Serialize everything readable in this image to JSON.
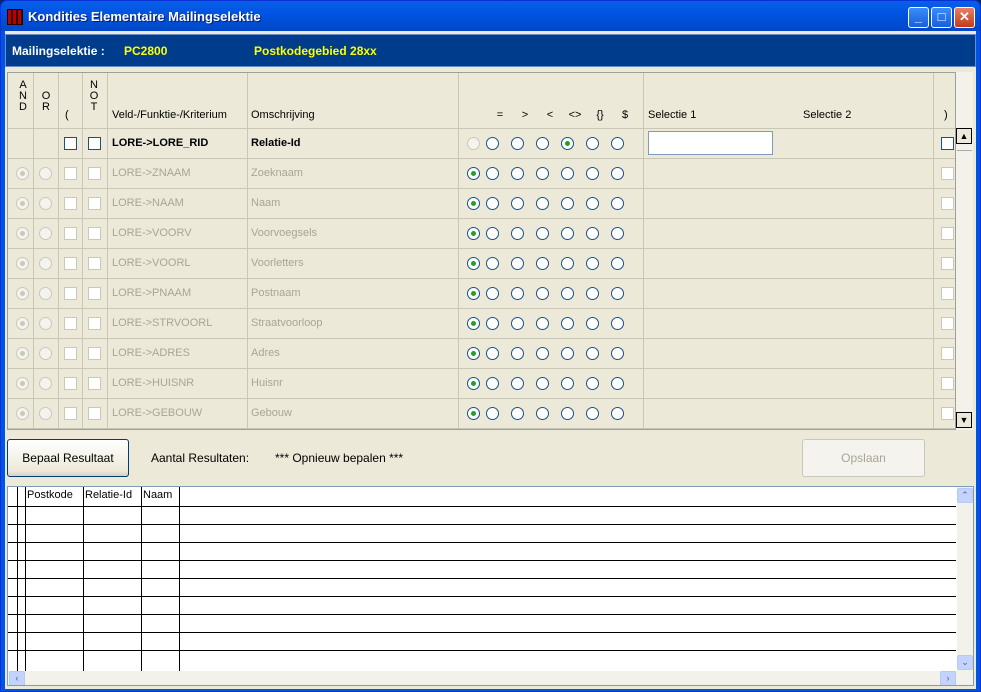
{
  "window": {
    "title": "Kondities Elementaire Mailingselektie",
    "minimize": "_",
    "maximize": "□",
    "close": "✕"
  },
  "header": {
    "label": "Mailingselektie :",
    "code": "PC2800",
    "area": "Postkodegebied 28xx"
  },
  "columns": {
    "and": [
      "A",
      "N",
      "D"
    ],
    "or": [
      "O",
      "R"
    ],
    "paren_open": "(",
    "not": [
      "N",
      "O",
      "T"
    ],
    "field": "Veld-/Funktie-/Kriterium",
    "desc": "Omschrijving",
    "ops": [
      "=",
      ">",
      "<",
      "<>",
      "{}",
      "$"
    ],
    "sel1": "Selectie 1",
    "sel2": "Selectie 2",
    "paren_close": ")"
  },
  "rows": [
    {
      "field": "LORE->LORE_RID",
      "desc": "Relatie-Id",
      "active": true,
      "op_selected": 4
    },
    {
      "field": "LORE->ZNAAM",
      "desc": "Zoeknaam",
      "active": false,
      "op_selected": 0
    },
    {
      "field": "LORE->NAAM",
      "desc": "Naam",
      "active": false,
      "op_selected": 0
    },
    {
      "field": "LORE->VOORV",
      "desc": "Voorvoegsels",
      "active": false,
      "op_selected": 0
    },
    {
      "field": "LORE->VOORL",
      "desc": "Voorletters",
      "active": false,
      "op_selected": 0
    },
    {
      "field": "LORE->PNAAM",
      "desc": "Postnaam",
      "active": false,
      "op_selected": 0
    },
    {
      "field": "LORE->STRVOORL",
      "desc": "Straatvoorloop",
      "active": false,
      "op_selected": 0
    },
    {
      "field": "LORE->ADRES",
      "desc": "Adres",
      "active": false,
      "op_selected": 0
    },
    {
      "field": "LORE->HUISNR",
      "desc": "Huisnr",
      "active": false,
      "op_selected": 0
    },
    {
      "field": "LORE->GEBOUW",
      "desc": "Gebouw",
      "active": false,
      "op_selected": 0
    }
  ],
  "actions": {
    "compute": "Bepaal Resultaat",
    "results_label": "Aantal Resultaten:",
    "results_value": "*** Opnieuw bepalen ***",
    "save": "Opslaan"
  },
  "results": {
    "columns": [
      "Postkode",
      "Relatie-Id",
      "Naam"
    ]
  }
}
